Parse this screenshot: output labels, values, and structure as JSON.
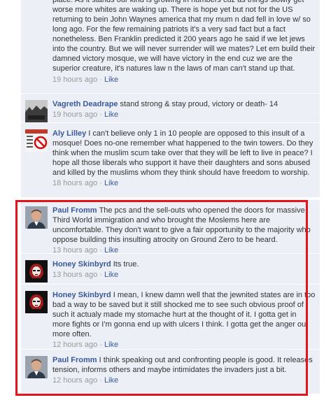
{
  "comments": [
    {
      "author": "",
      "text": "place. As it stands our kind is growing in numbers cuz as things slowly get worse more whites are waking up. There is hope yet but not for the US returning to bein John Waynes america that my mum n dad fell in love w/ so long ago. For the few remaining patriots it's a very sad fact but a fact nonetheless. Ben Franklin predicted it 200 years ago he said if we let jews into the country. But we will never surrender will we mates? Let em build their damned victory mosque, we will have victory in the end cuz we are the superior creature, it's natures law n the laws of man can't stand up that.",
      "time": "19 hours ago",
      "like": "Like"
    },
    {
      "author": "Vagreth Deadrape",
      "text": "stand strong & stay proud, victory or death- 14",
      "time": "19 hours ago",
      "like": "Like"
    },
    {
      "author": "Aly Lilley",
      "text": "I can't believe only 1 in 10 people are opposed to this insult of a mosque! Does no-one remember what happened to the twin towers. Do they think when the muslim scum take over that they will be left to live in peace? I hope all those liberals who support it have their daughters and sons abused and killed by the muslims whom they think should have freedom to worship.",
      "time": "18 hours ago",
      "like": "Like"
    },
    {
      "author": "Paul Fromm",
      "text": "The pcs and the sell-outs who opened the doors for massive Third World immigration and who brought the Moslems here are uncomfortable. They don't want to give a fair opportunity to the majority who oppose building this insulting atrocity on Ground Zero to be heard.",
      "time": "13 hours ago",
      "like": "Like"
    },
    {
      "author": "Honey Skinbyrd",
      "text": "Its true.",
      "time": "13 hours ago",
      "like": "Like"
    },
    {
      "author": "Honey Skinbyrd",
      "text": "I mean, I knew damn well that the jewnited states are in too bad a way to be saved but it still shocked me to see such obvious proof of such it actualy made my stomache hurt at the thought of it. I gotta get in more fights or I'm gonna end up with ulcers I think. I gotta get the anger out more often.",
      "time": "12 hours ago",
      "like": "Like"
    },
    {
      "author": "Paul Fromm",
      "text": "I think speaking out and confronting people is good. It releases tension, informs others and maybe intimidates the invaders just a bit.",
      "time": "12 hours ago",
      "like": "Like"
    }
  ],
  "avatar_icons": {
    "vagreth": "monochrome-landscape-photo",
    "aly": "no-symbol-poster",
    "paul": "man-portrait-photo",
    "honey": "woman-with-red-hair-photo"
  },
  "colors": {
    "comment_bg": "#eceff5",
    "link": "#3b5998",
    "meta": "#999999",
    "highlight": "#e3141b"
  }
}
